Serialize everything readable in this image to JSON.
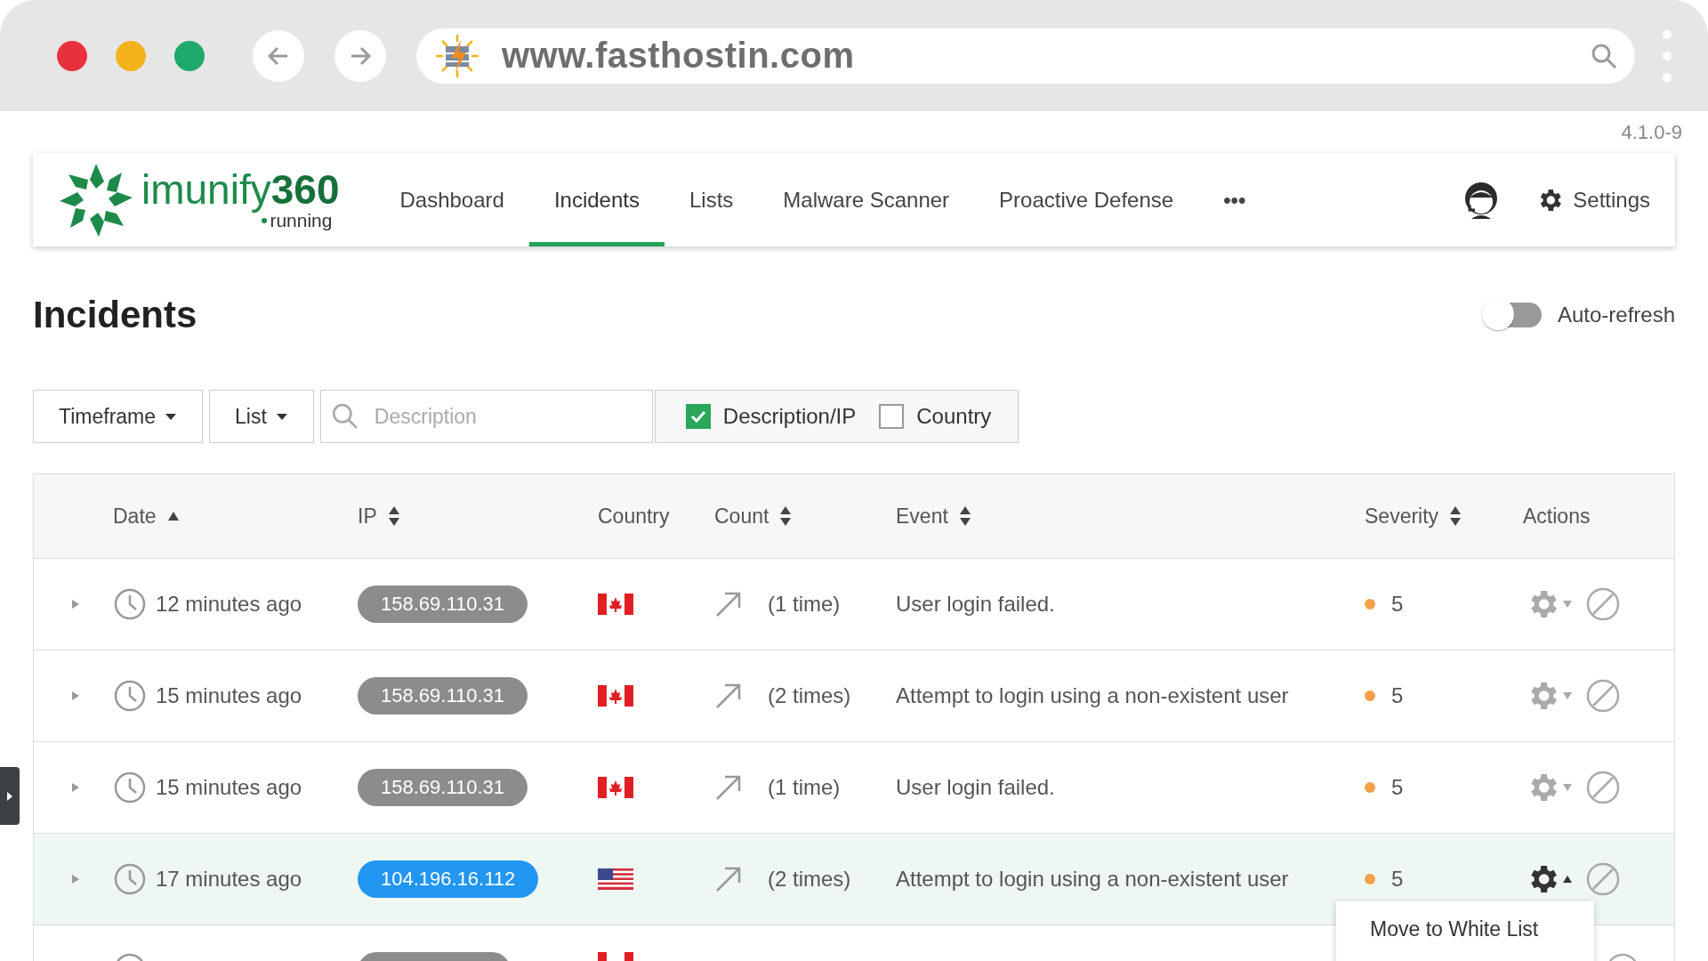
{
  "browser": {
    "url": "www.fasthostin.com"
  },
  "version": "4.1.0-9",
  "app": {
    "logo": "imunify**360**",
    "status": "running"
  },
  "nav": [
    {
      "label": "Dashboard",
      "selected": false
    },
    {
      "label": "Incidents",
      "selected": true
    },
    {
      "label": "Lists",
      "selected": false
    },
    {
      "label": "Malware Scanner",
      "selected": false
    },
    {
      "label": "Proactive Defense",
      "selected": false
    }
  ],
  "nav_more": "•••",
  "settings_label": "Settings",
  "page": {
    "title": "Incidents",
    "auto_refresh": {
      "label": "Auto-refresh",
      "on": false
    }
  },
  "filters": {
    "timeframe": "Timeframe",
    "list": "List",
    "search_placeholder": "Description",
    "checks": [
      {
        "label": "Description/IP",
        "checked": true
      },
      {
        "label": "Country",
        "checked": false
      }
    ]
  },
  "table": {
    "columns": [
      {
        "label": "Date",
        "kind": "asc"
      },
      {
        "label": "IP",
        "kind": "sortable"
      },
      {
        "label": "Country",
        "kind": "plain"
      },
      {
        "label": "Count",
        "kind": "sortable"
      },
      {
        "label": "Event",
        "kind": "sortable"
      },
      {
        "label": "Severity",
        "kind": "sortable"
      },
      {
        "label": "Actions",
        "kind": "plain"
      }
    ],
    "rows": [
      {
        "kind": "full",
        "date": "12 minutes ago",
        "ip": "158.69.110.31",
        "flag": {
          "kind": "ca"
        },
        "count": "(1 time)",
        "event": "User login failed.",
        "severity": "5",
        "selected": false,
        "menu_open": false
      },
      {
        "kind": "full",
        "date": "15 minutes ago",
        "ip": "158.69.110.31",
        "flag": {
          "kind": "ca"
        },
        "count": "(2 times)",
        "event": "Attempt to login using a non-existent user",
        "severity": "5",
        "selected": false,
        "menu_open": false
      },
      {
        "kind": "full",
        "date": "15 minutes ago",
        "ip": "158.69.110.31",
        "flag": {
          "kind": "ca"
        },
        "count": "(1 time)",
        "event": "User login failed.",
        "severity": "5",
        "selected": false,
        "menu_open": false
      },
      {
        "kind": "full",
        "date": "17 minutes ago",
        "ip": "104.196.16.112",
        "flag": {
          "kind": "us"
        },
        "count": "(2 times)",
        "event": "Attempt to login using a non-existent user",
        "severity": "5",
        "selected": true,
        "menu_open": true,
        "menu_items": [
          "Move to White List"
        ]
      },
      {
        "kind": "cut",
        "flag": {
          "kind": "ca"
        },
        "selected": false
      }
    ]
  }
}
